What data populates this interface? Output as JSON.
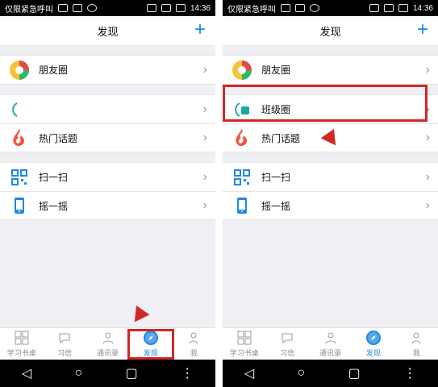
{
  "status": {
    "carrier": "仅限紧急呼叫",
    "time": "14:36"
  },
  "header": {
    "title": "发现",
    "plus": "+"
  },
  "left_list": {
    "items": [
      {
        "label": "朋友圈"
      },
      {
        "label": ""
      },
      {
        "label": "热门话题"
      },
      {
        "label": "扫一扫"
      },
      {
        "label": "摇一摇"
      }
    ]
  },
  "right_list": {
    "items": [
      {
        "label": "朋友圈"
      },
      {
        "label": "班级圈"
      },
      {
        "label": "热门话题"
      },
      {
        "label": "扫一扫"
      },
      {
        "label": "摇一摇"
      }
    ]
  },
  "tabs": [
    {
      "label": "学习书桌"
    },
    {
      "label": "习信"
    },
    {
      "label": "通讯录"
    },
    {
      "label": "发现"
    },
    {
      "label": "我"
    }
  ],
  "colors": {
    "accent": "#1e88e5",
    "annotation": "#d32626"
  }
}
